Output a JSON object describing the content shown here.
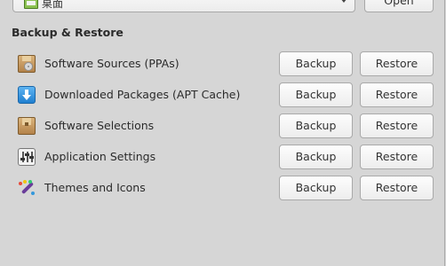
{
  "top": {
    "folder_combo_value": "桌面",
    "open_label": "Open"
  },
  "section": {
    "title": "Backup & Restore"
  },
  "items": [
    {
      "label": "Software Sources (PPAs)",
      "icon": "software-sources-icon",
      "backup_label": "Backup",
      "restore_label": "Restore"
    },
    {
      "label": "Downloaded Packages (APT Cache)",
      "icon": "download-icon",
      "backup_label": "Backup",
      "restore_label": "Restore"
    },
    {
      "label": "Software Selections",
      "icon": "package-icon",
      "backup_label": "Backup",
      "restore_label": "Restore"
    },
    {
      "label": "Application Settings",
      "icon": "settings-sliders-icon",
      "backup_label": "Backup",
      "restore_label": "Restore"
    },
    {
      "label": "Themes and Icons",
      "icon": "theme-brush-icon",
      "backup_label": "Backup",
      "restore_label": "Restore"
    }
  ]
}
